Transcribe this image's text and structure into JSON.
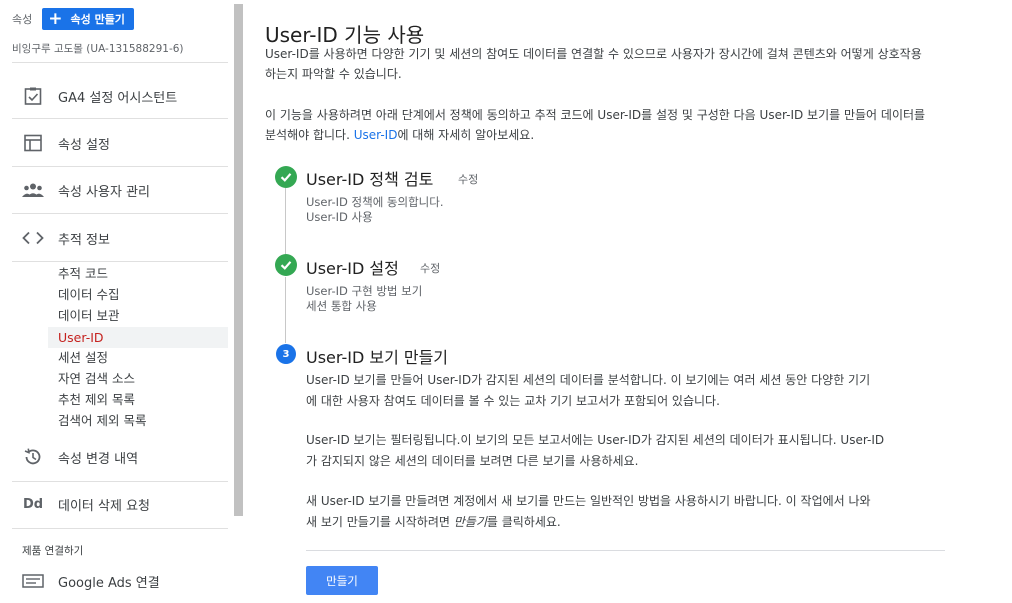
{
  "sidebar": {
    "property_label": "속성",
    "create_property": "속성 만들기",
    "property_name": "비잉구루 고도몰 (UA-131588291-6)",
    "items": [
      {
        "label": "GA4 설정 어시스턴트",
        "icon": "checklist-icon"
      },
      {
        "label": "속성 설정",
        "icon": "layout-icon"
      },
      {
        "label": "속성 사용자 관리",
        "icon": "people-icon"
      },
      {
        "label": "추적 정보",
        "icon": "code-icon"
      }
    ],
    "sub_items": [
      "추적 코드",
      "데이터 수집",
      "데이터 보관",
      "User-ID",
      "세션 설정",
      "자연 검색 소스",
      "추천 제외 목록",
      "검색어 제외 목록"
    ],
    "active_sub": "User-ID",
    "change_history": {
      "label": "속성 변경 내역",
      "icon": "history-icon"
    },
    "data_deletion": {
      "label": "데이터 삭제 요청",
      "icon": "Dd"
    },
    "product_linking_title": "제품 연결하기",
    "google_ads": {
      "label": "Google Ads 연결",
      "icon": "ads-icon"
    }
  },
  "main": {
    "title": "User-ID 기능 사용",
    "intro_line1": "User-ID를 사용하면 다양한 기기 및 세션의 참여도 데이터를 연결할 수 있으므로 사용자가 장시간에 걸쳐 콘텐츠와 어떻게 상호작용",
    "intro_line2": "하는지 파악할 수 있습니다.",
    "setup_line1": "이 기능을 사용하려면 아래 단계에서 정책에 동의하고 추적 코드에 User-ID를 설정 및 구성한 다음 User-ID 보기를 만들어 데이터를",
    "setup_line2_pre": "분석해야 합니다. ",
    "setup_link": "User-ID",
    "setup_line2_post": "에 대해 자세히 알아보세요.",
    "steps": [
      {
        "title": "User-ID 정책 검토",
        "edit": "수정",
        "desc1": "User-ID 정책에 동의합니다.",
        "desc2": "User-ID 사용"
      },
      {
        "title": "User-ID 설정",
        "edit": "수정",
        "desc1": "User-ID 구현 방법 보기",
        "desc2": "세션 통합 사용"
      },
      {
        "number": "3",
        "title": "User-ID 보기 만들기"
      }
    ],
    "step3_p1_line1": "User-ID 보기를 만들어 User-ID가 감지된 세션의 데이터를 분석합니다. 이 보기에는 여러 세션 동안 다양한 기기",
    "step3_p1_line2": "에 대한 사용자 참여도 데이터를 볼 수 있는 교차 기기 보고서가 포함되어 있습니다.",
    "step3_p2_line1": "User-ID 보기는 필터링됩니다.이 보기의 모든 보고서에는 User-ID가 감지된 세션의 데이터가 표시됩니다. User-ID",
    "step3_p2_line2": "가 감지되지 않은 세션의 데이터를 보려면 다른 보기를 사용하세요.",
    "step3_p3_line1": "새 User-ID 보기를 만들려면 계정에서 새 보기를 만드는 일반적인 방법을 사용하시기 바랍니다. 이 작업에서 나와",
    "step3_p3_line2_pre": "새 보기 만들기를 시작하려면 ",
    "step3_p3_em": "만들기",
    "step3_p3_line2_post": "를 클릭하세요.",
    "create_button": "만들기"
  },
  "colors": {
    "accent": "#1a73e8",
    "success": "#34a853",
    "active_text": "#c5221f"
  }
}
